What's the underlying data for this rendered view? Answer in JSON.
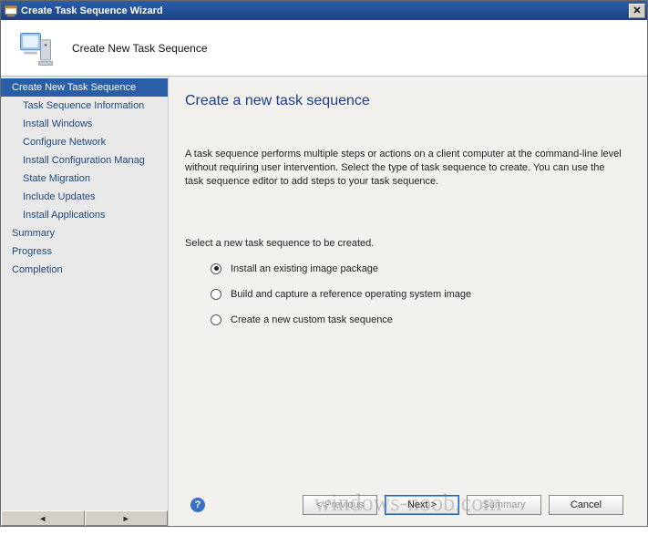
{
  "titlebar": {
    "title": "Create Task Sequence Wizard",
    "close_glyph": "✕"
  },
  "header": {
    "title": "Create New Task Sequence"
  },
  "sidebar": {
    "items": [
      {
        "label": "Create New Task Sequence",
        "selected": true,
        "sub": false
      },
      {
        "label": "Task Sequence Information",
        "selected": false,
        "sub": true
      },
      {
        "label": "Install Windows",
        "selected": false,
        "sub": true
      },
      {
        "label": "Configure Network",
        "selected": false,
        "sub": true
      },
      {
        "label": "Install Configuration Manag",
        "selected": false,
        "sub": true
      },
      {
        "label": "State Migration",
        "selected": false,
        "sub": true
      },
      {
        "label": "Include Updates",
        "selected": false,
        "sub": true
      },
      {
        "label": "Install Applications",
        "selected": false,
        "sub": true
      },
      {
        "label": "Summary",
        "selected": false,
        "sub": false
      },
      {
        "label": "Progress",
        "selected": false,
        "sub": false
      },
      {
        "label": "Completion",
        "selected": false,
        "sub": false
      }
    ],
    "scroll_left_glyph": "◄",
    "scroll_right_glyph": "►"
  },
  "main": {
    "heading": "Create a new task sequence",
    "description": "A task sequence performs multiple steps or actions on a client computer at the command-line level without requiring user intervention. Select the type of task sequence to create. You can use the task sequence editor to add steps to your task sequence.",
    "select_label": "Select a new task sequence to be created.",
    "options": [
      {
        "label": "Install an existing image package",
        "checked": true
      },
      {
        "label": "Build and capture a reference operating system image",
        "checked": false
      },
      {
        "label": "Create a new custom task sequence",
        "checked": false
      }
    ]
  },
  "footer": {
    "help_glyph": "?",
    "previous_label": "< Previous",
    "next_label": "Next >",
    "summary_label": "Summary",
    "cancel_label": "Cancel"
  },
  "watermark": "windows-noob.com"
}
